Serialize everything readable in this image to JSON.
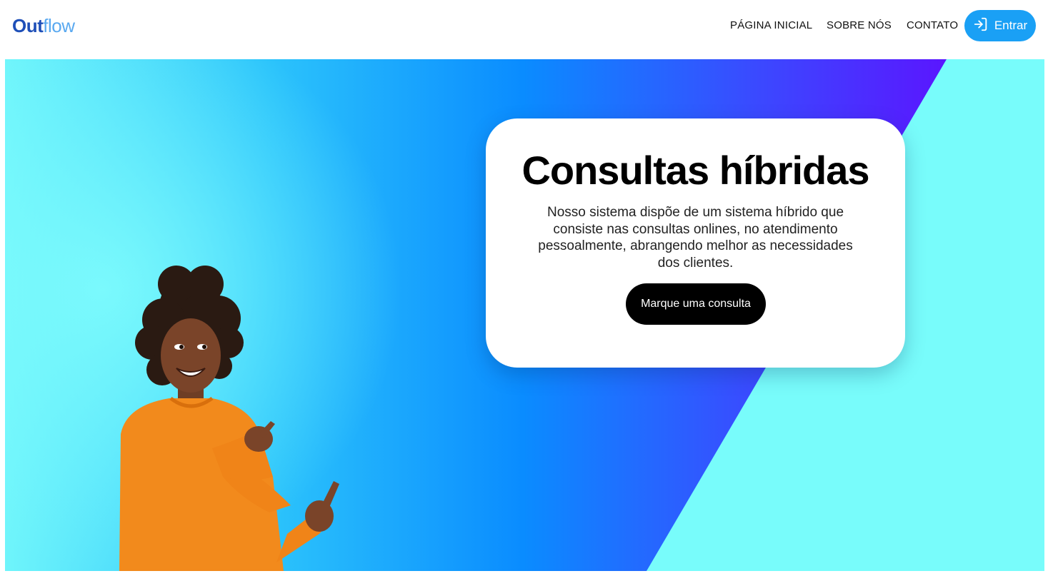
{
  "brand": {
    "logo_part1": "Out",
    "logo_part2": "flow"
  },
  "nav": {
    "items": [
      {
        "label": "PÁGINA INICIAL"
      },
      {
        "label": "SOBRE NÓS"
      },
      {
        "label": "CONTATO"
      }
    ],
    "login_label": "Entrar"
  },
  "hero": {
    "title": "Consultas híbridas",
    "description": "Nosso sistema dispõe de um sistema híbrido que consiste nas consultas onlines, no atendimento pessoalmente, abrangendo melhor as necessidades dos clientes.",
    "cta_label": "Marque uma consulta"
  },
  "colors": {
    "brand_dark": "#1e4fb8",
    "brand_light": "#5aa9f0",
    "login_button": "#1aa0f5",
    "hero_cyan": "#78fcfb",
    "gradient_blue": "#0a8cff",
    "gradient_violet": "#5a16ff",
    "cta_button": "#000000",
    "sweater": "#f28a1c"
  },
  "icons": {
    "login": "login-arrow-icon"
  },
  "image": {
    "subject": "smiling woman in orange sweater pointing to the right"
  }
}
